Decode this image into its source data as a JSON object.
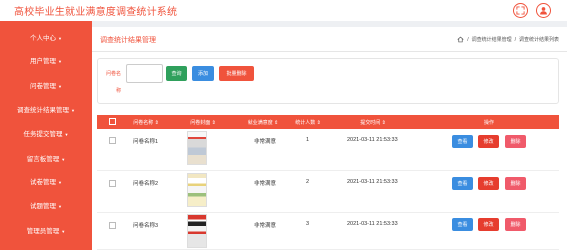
{
  "app": {
    "title": "高校毕业生就业满意度调查统计系统"
  },
  "header_icons": [
    "fullscreen-icon",
    "user-icon"
  ],
  "sidebar": {
    "items": [
      {
        "label": "个人中心"
      },
      {
        "label": "用户管理"
      },
      {
        "label": "问卷管理"
      },
      {
        "label": "调查统计结果管理"
      },
      {
        "label": "任务提交管理"
      },
      {
        "label": "留言板管理"
      },
      {
        "label": "试卷管理"
      },
      {
        "label": "试题管理"
      },
      {
        "label": "管理员管理"
      }
    ]
  },
  "page": {
    "title": "调查统计结果管理",
    "breadcrumb": [
      "调查统计结果管理",
      "调查统计结果列表"
    ]
  },
  "search": {
    "label_line1": "问卷名",
    "label_line2": "称",
    "input_value": "",
    "query_label": "查询",
    "add_label": "添加",
    "batch_delete_label": "批量删除"
  },
  "table": {
    "columns": [
      "问卷名称",
      "问卷封面",
      "就业满意度",
      "统计人数",
      "提交时间",
      "操作"
    ],
    "actions": {
      "view": "查看",
      "edit": "修改",
      "delete": "删除"
    },
    "rows": [
      {
        "name": "问卷名称1",
        "satisfaction": "非常满意",
        "count": "1",
        "time": "2021-03-11 21:53:33"
      },
      {
        "name": "问卷名称2",
        "satisfaction": "非常满意",
        "count": "2",
        "time": "2021-03-11 21:53:33"
      },
      {
        "name": "问卷名称3",
        "satisfaction": "非常满意",
        "count": "3",
        "time": "2021-03-11 21:53:33"
      }
    ]
  },
  "colors": {
    "accent": "#f0533c",
    "view": "#3a8de0",
    "edit": "#e63d2e",
    "delete": "#f05a6a",
    "query": "#2fa05c"
  }
}
